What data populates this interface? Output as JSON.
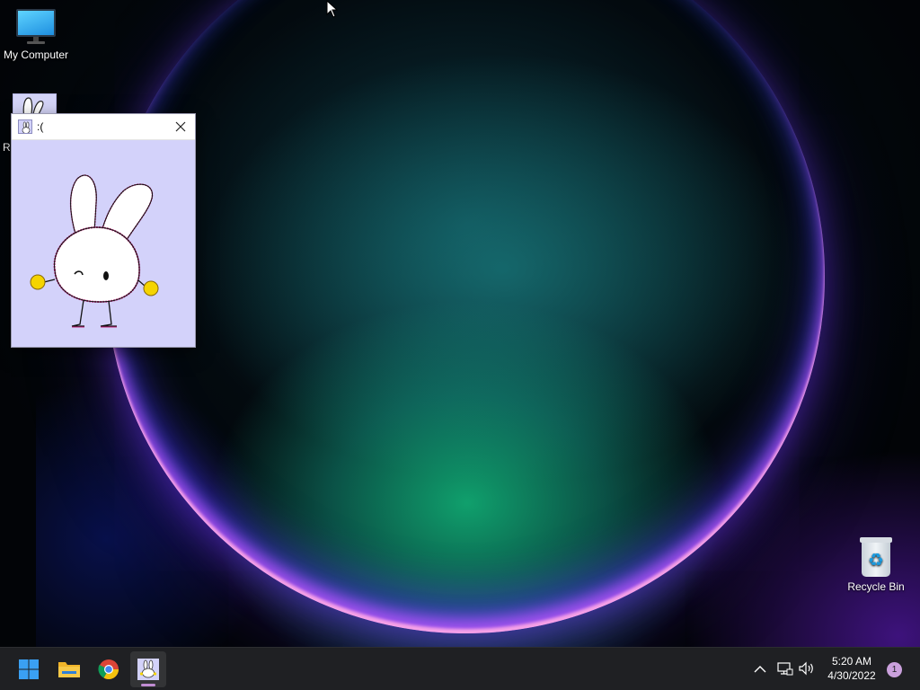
{
  "desktop": {
    "icons": [
      {
        "label": "My Computer",
        "icon": "monitor-icon"
      },
      {
        "label": "R",
        "icon": "bunny-app-icon"
      },
      {
        "label": "Recycle Bin",
        "icon": "recycle-bin-icon"
      }
    ]
  },
  "window": {
    "title": ":(",
    "icon": "bunny-app-icon",
    "close_icon": "close-icon",
    "background": "#d3d2fa"
  },
  "taskbar": {
    "apps": [
      {
        "name": "start",
        "icon": "windows-logo-icon"
      },
      {
        "name": "file-explorer",
        "icon": "folder-icon"
      },
      {
        "name": "chrome",
        "icon": "chrome-icon"
      },
      {
        "name": "bunny-app",
        "icon": "bunny-app-icon",
        "active": true
      }
    ],
    "tray": {
      "chevron_icon": "chevron-up-icon",
      "network_icon": "network-icon",
      "volume_icon": "volume-icon"
    },
    "clock": {
      "time": "5:20 AM",
      "date": "4/30/2022"
    },
    "notification_count": "1"
  },
  "colors": {
    "accent": "#c08cd2",
    "taskbar": "#1f2023",
    "window_bg": "#d3d2fa",
    "bunny_cheeks": "#f5d400"
  }
}
